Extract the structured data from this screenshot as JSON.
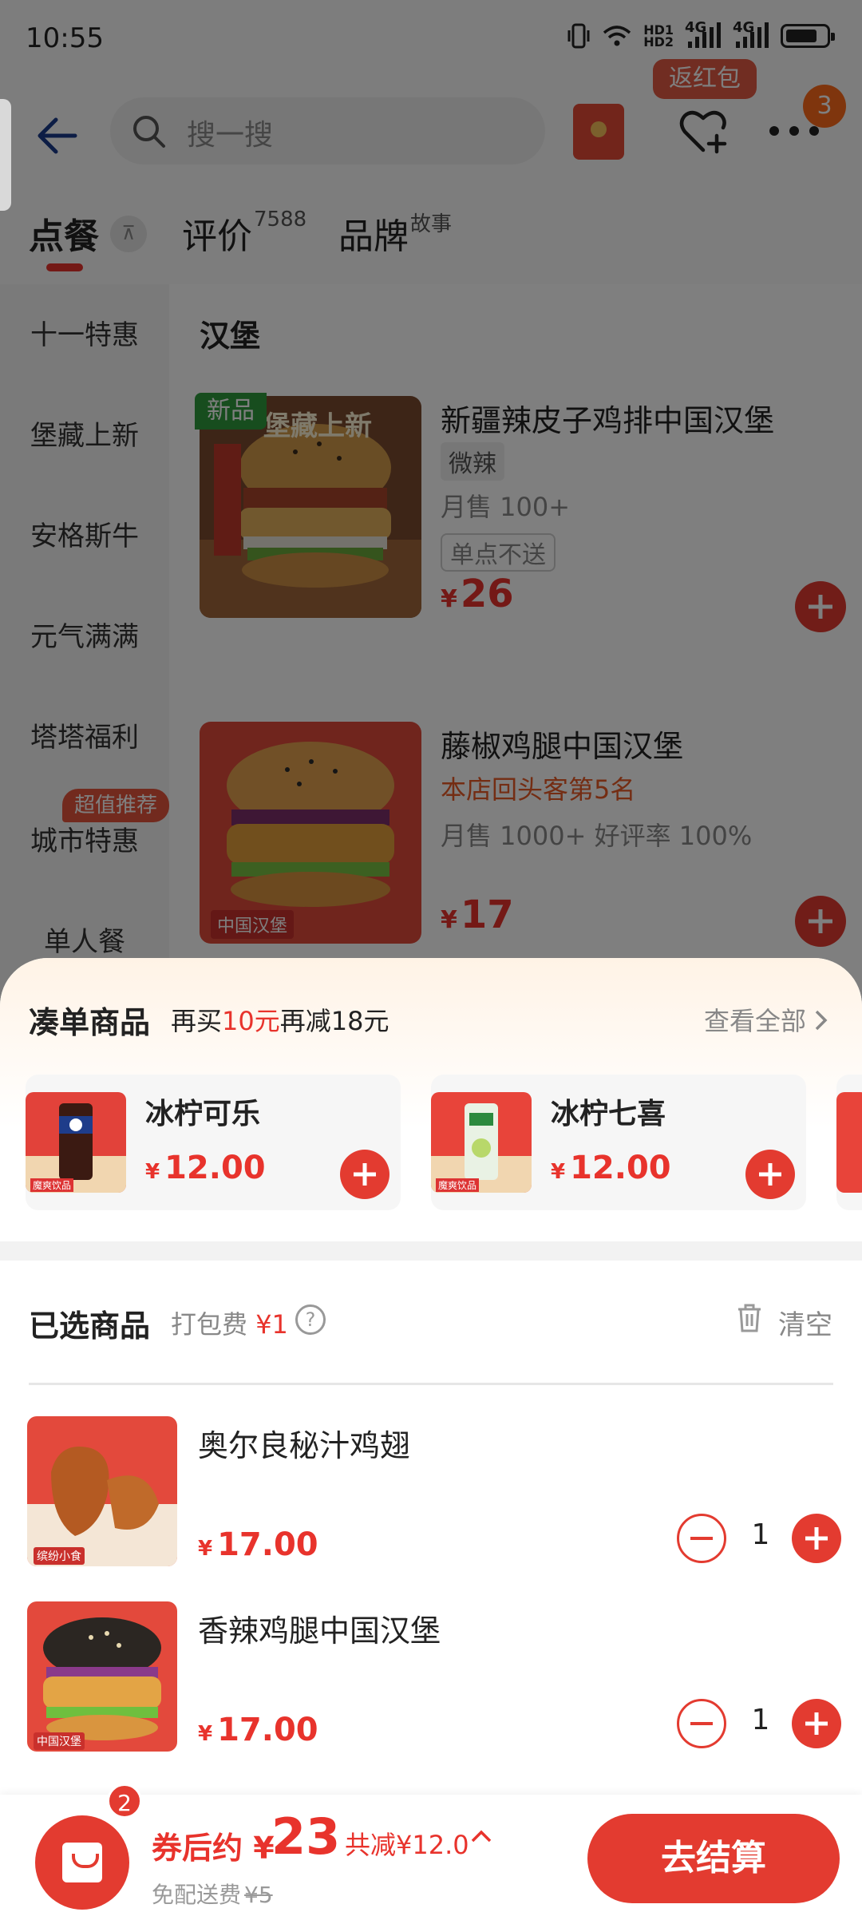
{
  "status_bar": {
    "time": "10:55",
    "network_label": "4G",
    "network_label_2": "4G",
    "hd1": "HD1",
    "hd2": "HD2"
  },
  "top_bar": {
    "search_placeholder": "搜一搜",
    "return_redpacket_label": "返红包",
    "more_badge_count": "3"
  },
  "tabs": [
    {
      "label": "点餐",
      "sup": ""
    },
    {
      "label": "评价",
      "sup": "7588"
    },
    {
      "label": "品牌",
      "sup": "故事"
    }
  ],
  "pin_icon_glyph": "⊼",
  "sidebar": {
    "items": [
      "十一特惠",
      "堡藏上新",
      "安格斯牛",
      "元气满满",
      "塔塔福利",
      "城市特惠",
      "单人餐"
    ],
    "badge": "超值推荐"
  },
  "menu": {
    "category_title": "汉堡",
    "dishes": [
      {
        "new_tag": "新品",
        "img_text": "堡藏上新",
        "name": "新疆辣皮子鸡排中国汉堡",
        "spice": "微辣",
        "sales": "月售 100+",
        "note": "单点不送",
        "currency": "¥",
        "price": "26"
      },
      {
        "img_text": "中国汉堡",
        "name": "藤椒鸡腿中国汉堡",
        "rank": "本店回头客第5名",
        "sales": "月售 1000+  好评率 100%",
        "currency": "¥",
        "price": "17"
      }
    ]
  },
  "sheet": {
    "bundle": {
      "title": "凑单商品",
      "promo_pre": "再买",
      "promo_amount": "10元",
      "promo_post": "再减18元",
      "view_all": "查看全部",
      "items": [
        {
          "name": "冰柠可乐",
          "currency": "¥",
          "price": "12.00",
          "img_text": "魔爽饮品"
        },
        {
          "name": "冰柠七喜",
          "currency": "¥",
          "price": "12.00",
          "img_text": "魔爽饮品"
        }
      ]
    },
    "selected": {
      "title": "已选商品",
      "pack_fee_label": "打包费",
      "pack_fee_value": "¥1",
      "help_glyph": "?",
      "clear_label": "清空",
      "items": [
        {
          "name": "奥尔良秘汁鸡翅",
          "currency": "¥",
          "price": "17.00",
          "qty": "1",
          "img_text": "缤纷小食"
        },
        {
          "name": "香辣鸡腿中国汉堡",
          "currency": "¥",
          "price": "17.00",
          "qty": "1",
          "img_text": "中国汉堡"
        }
      ]
    }
  },
  "checkout": {
    "cart_count": "2",
    "price_label": "券后约 ¥",
    "price": "23",
    "saving": "共减¥12.0",
    "free_delivery_label": "免配送费",
    "original_fee": "¥5",
    "button_label": "去结算"
  },
  "colors": {
    "accent": "#e33b30",
    "price_red": "#e8332c",
    "new_tag_green": "#2f9b3d",
    "badge_orange": "#ff6b1a"
  }
}
